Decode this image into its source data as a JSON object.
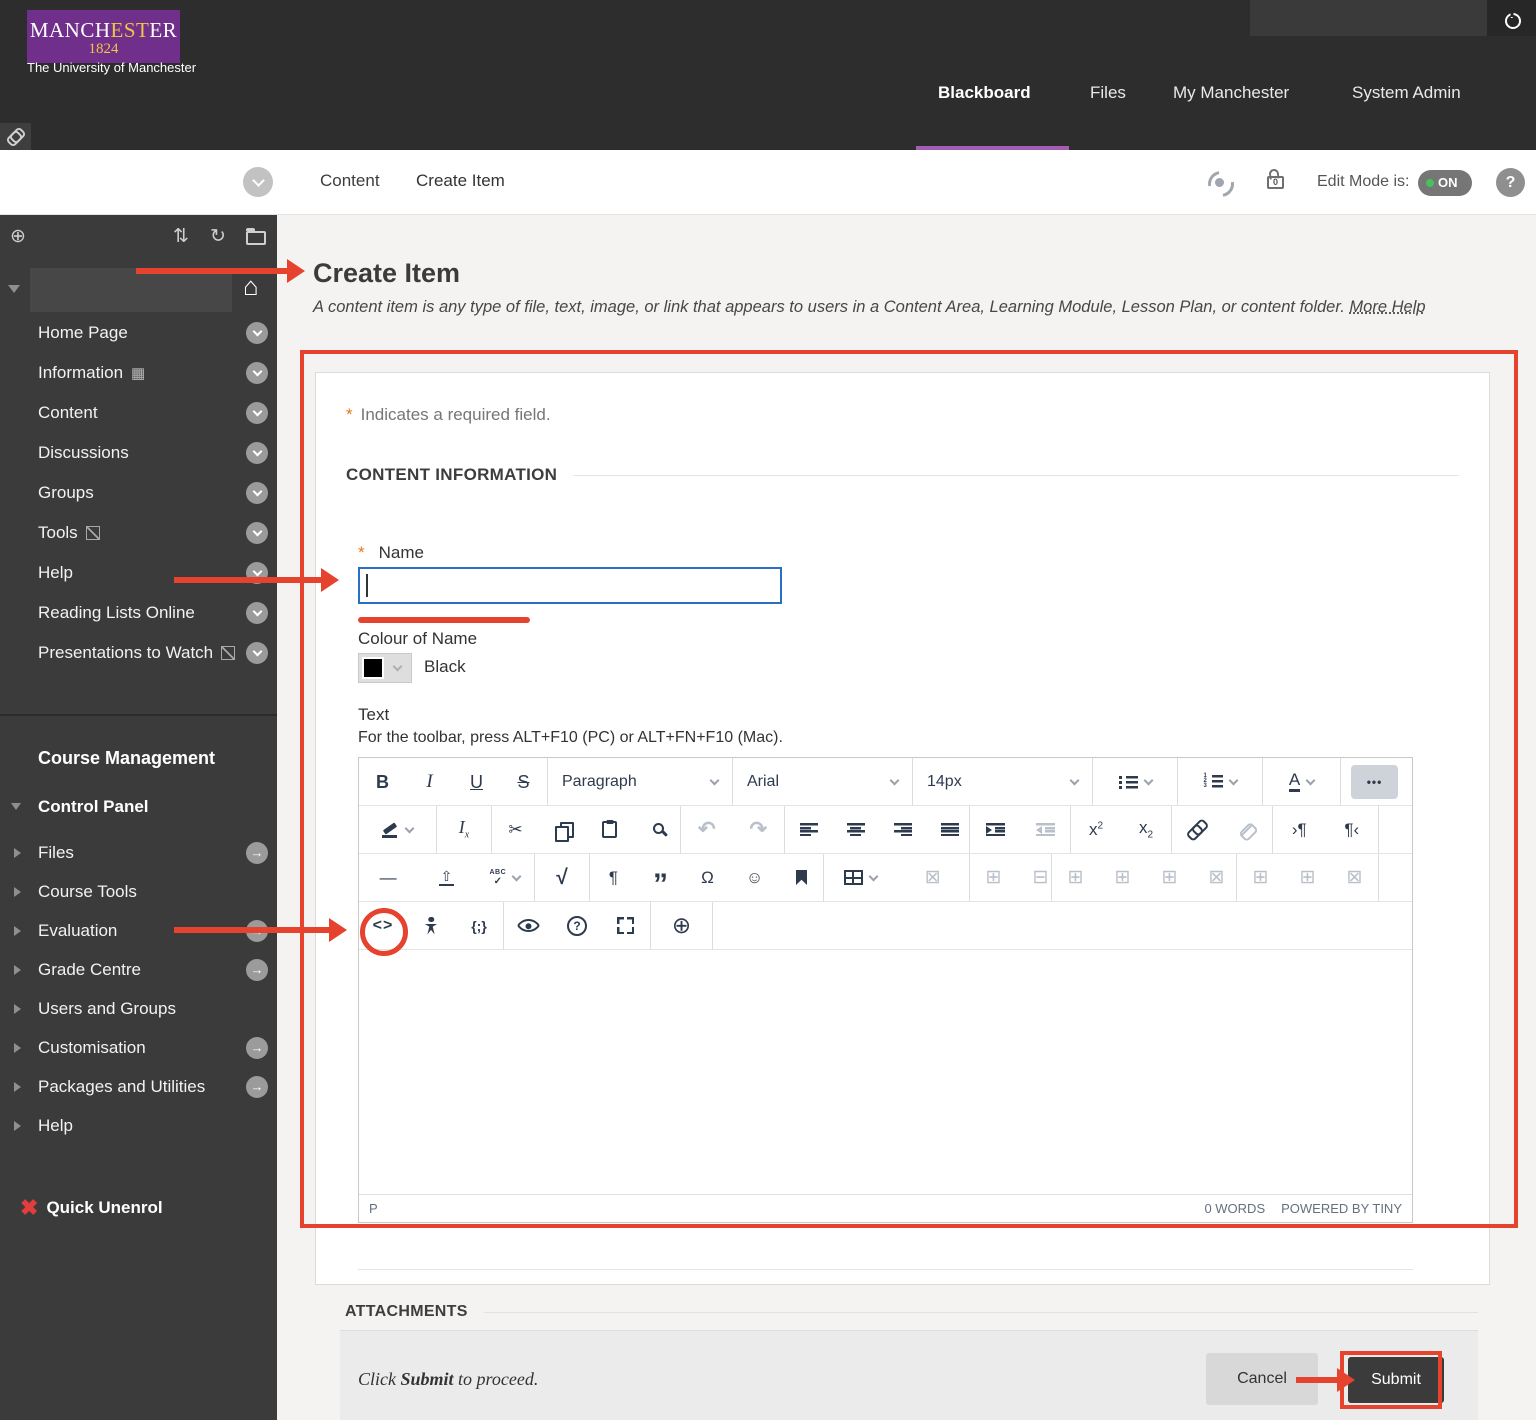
{
  "colors": {
    "accent_red": "#e5432d",
    "brand_purple": "#702f8a",
    "tab_underline": "#a55cb5",
    "edit_on_green": "#46c25a",
    "input_focus_blue": "#2a70c2"
  },
  "header": {
    "logo": {
      "part1": "MANCH",
      "part2": "EST",
      "part3": "ER",
      "year": "1824",
      "subtitle": "The University of Manchester"
    },
    "tabs": [
      {
        "label": "Blackboard"
      },
      {
        "label": "Files"
      },
      {
        "label": "My Manchester"
      },
      {
        "label": "System Admin"
      }
    ]
  },
  "breadcrumb": {
    "items": [
      "Content",
      "Create Item"
    ],
    "lock_count": "0",
    "edit_mode_label": "Edit Mode is:",
    "edit_mode_state": "ON",
    "help_label": "?"
  },
  "sidebar": {
    "menu": [
      {
        "label": "Home Page"
      },
      {
        "label": "Information",
        "icon": "window"
      },
      {
        "label": "Content"
      },
      {
        "label": "Discussions"
      },
      {
        "label": "Groups"
      },
      {
        "label": "Tools",
        "icon": "hidden"
      },
      {
        "label": "Help"
      },
      {
        "label": "Reading Lists Online"
      },
      {
        "label": "Presentations to Watch",
        "icon": "hidden"
      }
    ],
    "course_management": {
      "title": "Course Management",
      "control_panel": "Control Panel",
      "items": [
        {
          "label": "Files",
          "arrow": true
        },
        {
          "label": "Course Tools"
        },
        {
          "label": "Evaluation",
          "arrow": true
        },
        {
          "label": "Grade Centre",
          "arrow": true
        },
        {
          "label": "Users and Groups"
        },
        {
          "label": "Customisation",
          "arrow": true
        },
        {
          "label": "Packages and Utilities",
          "arrow": true
        },
        {
          "label": "Help"
        }
      ],
      "quick_unenrol": "Quick Unenrol"
    }
  },
  "main": {
    "title": "Create Item",
    "description": "A content item is any type of file, text, image, or link that appears to users in a Content Area, Learning Module, Lesson Plan, or content folder.",
    "more_help": "More Help",
    "required_note": "Indicates a required field.",
    "asterisk": "*",
    "section_title": "CONTENT INFORMATION",
    "name_label": "Name",
    "name_value": "",
    "colour_label": "Colour of Name",
    "colour_value": "Black",
    "text_label": "Text",
    "toolbar_hint": "For the toolbar, press ALT+F10 (PC) or ALT+FN+F10 (Mac).",
    "attachments_title": "ATTACHMENTS",
    "submit_hint_pre": "Click ",
    "submit_hint_bold": "Submit",
    "submit_hint_post": " to proceed.",
    "cancel_label": "Cancel",
    "submit_label": "Submit"
  },
  "editor": {
    "status_left": "P",
    "word_count": "0 WORDS",
    "powered_by": "POWERED BY TINY",
    "toolbar_rows": [
      [
        {
          "buttons": [
            {
              "n": "bold",
              "t": "B",
              "cls": "g-bold"
            },
            {
              "n": "italic",
              "t": "I",
              "cls": "g-italic"
            },
            {
              "n": "underline",
              "t": "U",
              "cls": "g-underline"
            },
            {
              "n": "strikethrough",
              "t": "S",
              "cls": "g-strike"
            }
          ]
        },
        {
          "gw": 185,
          "buttons": [
            {
              "n": "format-select",
              "select": "Paragraph"
            }
          ]
        },
        {
          "gw": 180,
          "buttons": [
            {
              "n": "font-select",
              "select": "Arial"
            }
          ]
        },
        {
          "gw": 180,
          "buttons": [
            {
              "n": "fontsize-select",
              "select": "14px"
            }
          ]
        },
        {
          "gw": 85,
          "buttons": [
            {
              "n": "bullet-list",
              "shape": "ul",
              "chev": true
            }
          ]
        },
        {
          "gw": 85,
          "buttons": [
            {
              "n": "numbered-list",
              "shape": "ol",
              "chev": true
            }
          ]
        },
        {
          "gw": 78,
          "buttons": [
            {
              "n": "text-color",
              "t": "A",
              "cls": "g-acolor",
              "chev": true
            }
          ]
        },
        {
          "fill": true,
          "buttons": [
            {
              "n": "more-tools",
              "t": "•••",
              "cls": "g-more",
              "active": true
            }
          ]
        }
      ],
      [
        {
          "gw": 78,
          "buttons": [
            {
              "n": "highlight",
              "shape": "pen",
              "chev": true
            }
          ]
        },
        {
          "gw": 55,
          "buttons": [
            {
              "n": "clear-formatting",
              "main": "I",
              "sub": "x",
              "cls": "g-ital"
            }
          ]
        },
        {
          "gw": 189,
          "buttons": [
            {
              "n": "cut",
              "t": "✂"
            },
            {
              "n": "copy",
              "shape": "copy"
            },
            {
              "n": "paste",
              "shape": "paste"
            },
            {
              "n": "search",
              "shape": "magnifier"
            }
          ]
        },
        {
          "gw": 104,
          "buttons": [
            {
              "n": "undo",
              "t": "↶",
              "cls": "g-big",
              "dis": true
            },
            {
              "n": "redo",
              "t": "↷",
              "cls": "g-big",
              "dis": true
            }
          ]
        },
        {
          "gw": 185,
          "buttons": [
            {
              "n": "align-left",
              "shape": "al-l"
            },
            {
              "n": "align-center",
              "shape": "al-c"
            },
            {
              "n": "align-right",
              "shape": "al-r"
            },
            {
              "n": "align-justify",
              "shape": "al-j"
            }
          ]
        },
        {
          "gw": 101,
          "buttons": [
            {
              "n": "indent",
              "shape": "indent"
            },
            {
              "n": "outdent",
              "shape": "outdent",
              "dis": true
            }
          ]
        },
        {
          "gw": 101,
          "buttons": [
            {
              "n": "superscript",
              "main": "x",
              "sup": "2"
            },
            {
              "n": "subscript",
              "main": "x",
              "sub": "2"
            }
          ]
        },
        {
          "gw": 101,
          "buttons": [
            {
              "n": "insert-link",
              "shape": "link"
            },
            {
              "n": "remove-link",
              "shape": "unlink",
              "dis": true
            }
          ]
        },
        {
          "gw": 106,
          "buttons": [
            {
              "n": "ltr-paragraph",
              "t": "›¶"
            },
            {
              "n": "rtl-paragraph",
              "t": "¶‹"
            }
          ]
        }
      ],
      [
        {
          "gw": 176,
          "buttons": [
            {
              "n": "horizontal-line",
              "t": "—"
            },
            {
              "n": "insert-content",
              "t": "⇧",
              "cls": "g-underbar"
            },
            {
              "n": "spellcheck",
              "stack": [
                "ABC",
                "✓"
              ],
              "chev": true
            }
          ]
        },
        {
          "gw": 55,
          "buttons": [
            {
              "n": "math-editor",
              "t": "√",
              "cls": "g-big"
            }
          ]
        },
        {
          "gw": 234,
          "buttons": [
            {
              "n": "show-invisibles",
              "t": "¶"
            },
            {
              "n": "blockquote",
              "t": "”",
              "cls": "g-quote"
            },
            {
              "n": "special-character",
              "t": "Ω"
            },
            {
              "n": "emoticons",
              "t": "☺"
            },
            {
              "n": "anchor",
              "shape": "bookmark"
            }
          ]
        },
        {
          "gw": 146,
          "buttons": [
            {
              "n": "insert-table",
              "shape": "table",
              "chev": true
            },
            {
              "n": "delete-table",
              "t": "⊠",
              "cls": "g-tbl",
              "dis": true
            }
          ]
        },
        {
          "gw": 82,
          "buttons": [
            {
              "n": "table-row-properties",
              "t": "⊞",
              "cls": "g-tbl",
              "dis": true
            },
            {
              "n": "table-cell-properties",
              "t": "⊟",
              "cls": "g-tbl",
              "dis": true
            }
          ]
        },
        {
          "gw": 185,
          "buttons": [
            {
              "n": "insert-row-above",
              "t": "⊞",
              "cls": "g-tbl",
              "dis": true
            },
            {
              "n": "insert-row-below",
              "t": "⊞",
              "cls": "g-tbl",
              "dis": true
            },
            {
              "n": "delete-row",
              "t": "⊞",
              "cls": "g-tbl",
              "dis": true
            },
            {
              "n": "row-menu",
              "t": "⊠",
              "cls": "g-tbl",
              "dis": true
            }
          ]
        },
        {
          "gw": 142,
          "buttons": [
            {
              "n": "insert-column-left",
              "t": "⊞",
              "cls": "g-tbl",
              "dis": true
            },
            {
              "n": "insert-column-right",
              "t": "⊞",
              "cls": "g-tbl",
              "dis": true
            },
            {
              "n": "delete-column",
              "t": "⊠",
              "cls": "g-tbl",
              "dis": true
            }
          ]
        }
      ],
      [
        {
          "gw": 145,
          "buttons": [
            {
              "n": "source-code",
              "t": "<>",
              "cls": "g-code"
            },
            {
              "n": "accessibility-checker",
              "shape": "person"
            },
            {
              "n": "code-sample",
              "t": "{;}",
              "cls": "g-codesample"
            }
          ]
        },
        {
          "gw": 147,
          "buttons": [
            {
              "n": "preview",
              "shape": "eye"
            },
            {
              "n": "editor-help",
              "t": "?",
              "cls": "g-qcirc"
            },
            {
              "n": "fullscreen",
              "shape": "fullscreen"
            }
          ]
        },
        {
          "gw": 62,
          "buttons": [
            {
              "n": "add-content",
              "t": "⊕",
              "cls": "g-plus"
            }
          ]
        }
      ]
    ]
  }
}
